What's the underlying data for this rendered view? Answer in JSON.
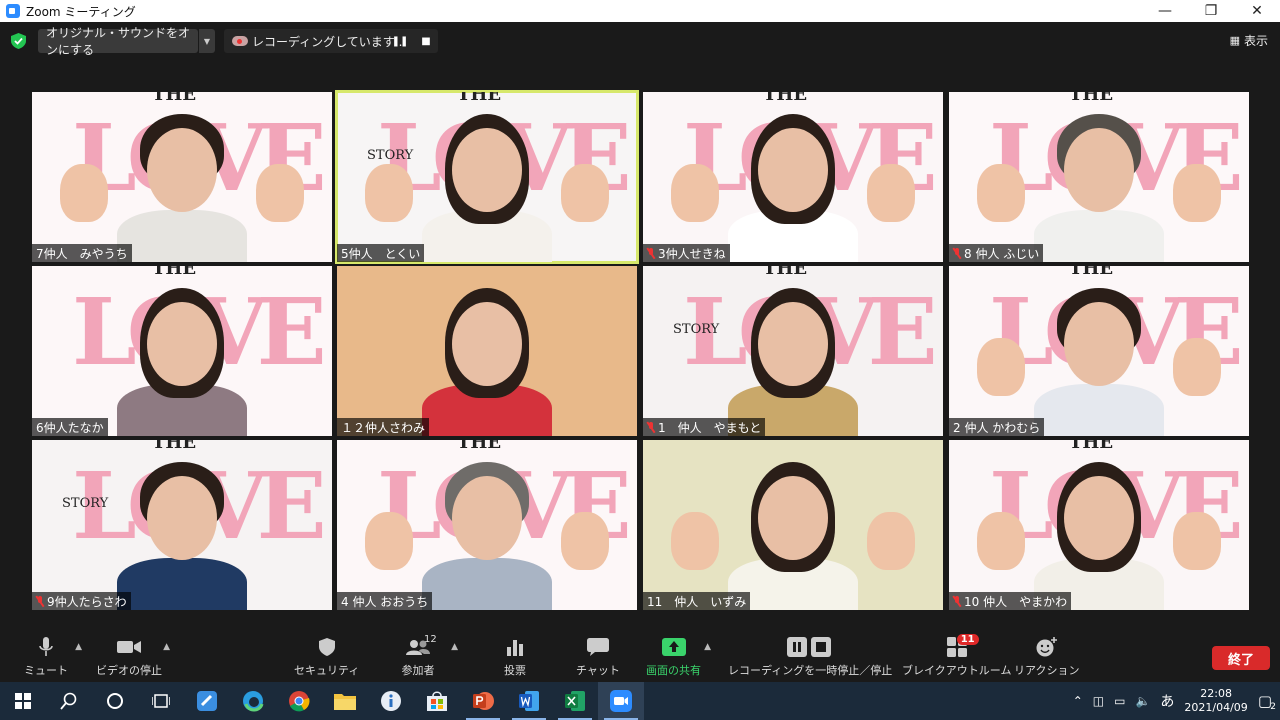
{
  "window": {
    "title": "Zoom ミーティング"
  },
  "topbar": {
    "original_sound": "オリジナル・サウンドをオンにする",
    "recording_status": "レコーディングしています...",
    "view_label": "表示"
  },
  "colors": {
    "accent_green": "#3ad36b",
    "end_red": "#d92a2a",
    "active_speaker": "#d7e86b"
  },
  "participants": [
    {
      "name": "7仲人　みやうち",
      "muted": false
    },
    {
      "name": "5仲人　とくい",
      "muted": false,
      "active": true
    },
    {
      "name": "3仲人せきね",
      "muted": true
    },
    {
      "name": "8 仲人 ふじい",
      "muted": true
    },
    {
      "name": "6仲人たなか",
      "muted": false
    },
    {
      "name": "１２仲人さわみ",
      "muted": false
    },
    {
      "name": "1　仲人　やまもと",
      "muted": true
    },
    {
      "name": "2 仲人 かわむら",
      "muted": false
    },
    {
      "name": "9仲人たらさわ",
      "muted": true
    },
    {
      "name": "4 仲人 おおうち",
      "muted": false
    },
    {
      "name": "11　仲人　いずみ",
      "muted": false
    },
    {
      "name": "10 仲人　やまかわ",
      "muted": true
    }
  ],
  "background_text": {
    "the": "THE",
    "love": "LOVE",
    "story": "STORY"
  },
  "toolbar": {
    "mute": "ミュート",
    "video_stop": "ビデオの停止",
    "security": "セキュリティ",
    "participants": "参加者",
    "participants_count": "12",
    "poll": "投票",
    "chat": "チャット",
    "share_screen": "画面の共有",
    "recording_pause": "レコーディングを一時停止／停止",
    "breakout": "ブレイクアウトルーム",
    "breakout_badge": "11",
    "reactions": "リアクション",
    "end": "終了"
  },
  "taskbar": {
    "time": "22:08",
    "date": "2021/04/09",
    "ime": "あ",
    "notifications": "2"
  }
}
